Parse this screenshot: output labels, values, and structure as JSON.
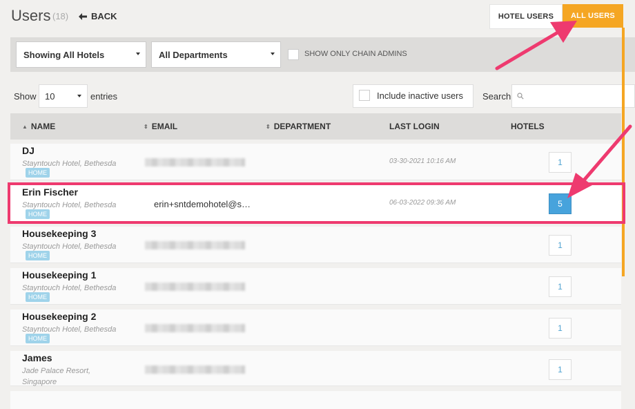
{
  "header": {
    "title": "Users",
    "count": "(18)",
    "back_label": "BACK"
  },
  "tabs": [
    {
      "label": "HOTEL USERS",
      "active": false
    },
    {
      "label": "ALL USERS",
      "active": true
    }
  ],
  "filters": {
    "hotel_select": "Showing All Hotels",
    "department_select": "All Departments",
    "chain_admins_label": "SHOW ONLY CHAIN ADMINS",
    "chain_admins_checked": false
  },
  "table_controls": {
    "show_label": "Show",
    "entries_value": "10",
    "entries_label": "entries",
    "include_inactive_label": "Include inactive users",
    "include_inactive_checked": false,
    "search_label": "Search",
    "search_value": ""
  },
  "columns": [
    "NAME",
    "EMAIL",
    "DEPARTMENT",
    "LAST LOGIN",
    "HOTELS"
  ],
  "rows": [
    {
      "name": "DJ",
      "hotel": "Stayntouch Hotel, Bethesda",
      "badge": "HOME",
      "email": "",
      "last_login": "03-30-2021 10:16 AM",
      "hotels": "1"
    },
    {
      "name": "Erin Fischer",
      "hotel": "Stayntouch Hotel, Bethesda",
      "badge": "HOME",
      "email": "erin+sntdemohotel@s…",
      "last_login": "06-03-2022 09:36 AM",
      "hotels": "5"
    },
    {
      "name": "Housekeeping 3",
      "hotel": "Stayntouch Hotel, Bethesda",
      "badge": "HOME",
      "email": "",
      "last_login": "",
      "hotels": "1"
    },
    {
      "name": "Housekeeping 1",
      "hotel": "Stayntouch Hotel, Bethesda",
      "badge": "HOME",
      "email": "",
      "last_login": "",
      "hotels": "1"
    },
    {
      "name": "Housekeeping 2",
      "hotel": "Stayntouch Hotel, Bethesda",
      "badge": "HOME",
      "email": "",
      "last_login": "",
      "hotels": "1"
    },
    {
      "name": "James",
      "hotel": "Jade Palace Resort, Singapore",
      "badge": "",
      "email": "",
      "last_login": "",
      "hotels": "1"
    }
  ],
  "colors": {
    "accent_orange": "#f5a623",
    "annotation_pink": "#ee3a6f",
    "hotels_active": "#47a3dc",
    "badge": "#9fd3ea"
  }
}
